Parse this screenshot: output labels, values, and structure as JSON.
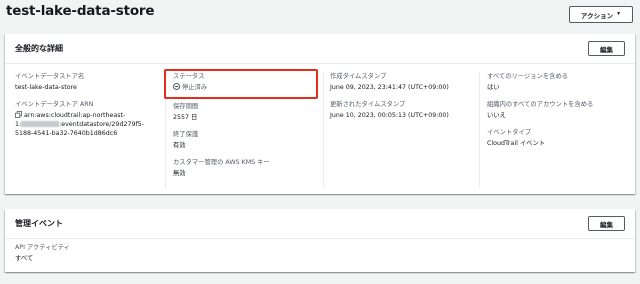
{
  "header": {
    "title": "test-lake-data-store",
    "action_label": "アクション"
  },
  "general": {
    "title": "全般的な詳細",
    "edit_label": "編集",
    "col1": {
      "name_label": "イベントデータストア名",
      "name_value": "test-lake-data-store",
      "arn_label": "イベントデータストア ARN",
      "arn_line1": "arn:aws:cloudtrail:ap-northeast-",
      "arn_line2_suffix": ":eventdatastore/29d279f5-",
      "arn_line2_prefix": "1:",
      "arn_line3": "5188-4541-ba32-7640b1d86dc6"
    },
    "col2": {
      "status_label": "ステータス",
      "status_value": "停止済み",
      "retention_label": "保存期間",
      "retention_value": "2557 日",
      "termination_label": "終了保護",
      "termination_value": "有効",
      "kms_label": "カスタマー管理の AWS KMS キー",
      "kms_value": "無効"
    },
    "col3": {
      "created_label": "作成タイムスタンプ",
      "created_value": "June 09, 2023, 23:41:47 (UTC+09:00)",
      "updated_label": "更新されたタイムスタンプ",
      "updated_value": "June 10, 2023, 00:05:13 (UTC+09:00)"
    },
    "col4": {
      "all_regions_label": "すべてのリージョンを含める",
      "all_regions_value": "はい",
      "org_label": "組織内のすべてのアカウントを含める",
      "org_value": "いいえ",
      "event_type_label": "イベントタイプ",
      "event_type_value": "CloudTrail イベント"
    }
  },
  "management": {
    "title": "管理イベント",
    "edit_label": "編集",
    "api_label": "API アクティビティ",
    "api_value": "すべて"
  },
  "colors": {
    "highlight": "#e62c1d",
    "text": "#16191f",
    "muted": "#545b64"
  }
}
